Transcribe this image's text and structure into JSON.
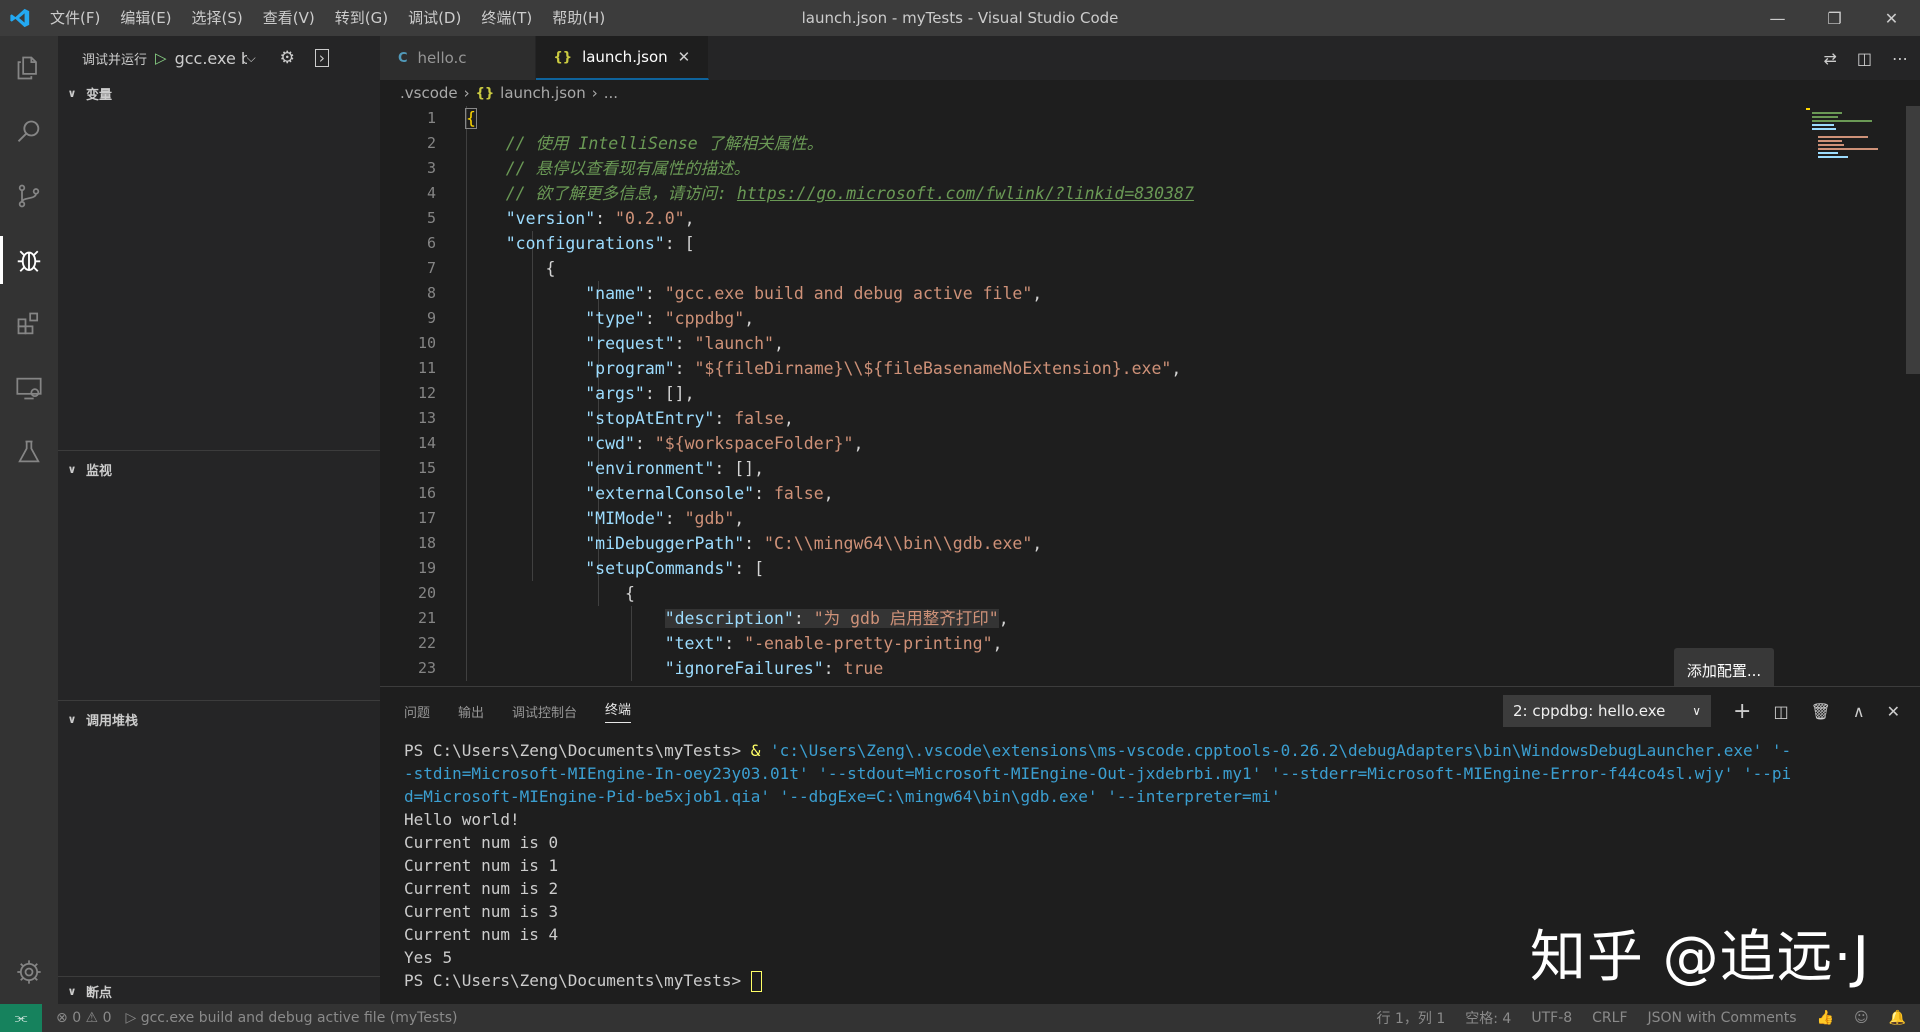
{
  "titlebar": {
    "menu": [
      "文件(F)",
      "编辑(E)",
      "选择(S)",
      "查看(V)",
      "转到(G)",
      "调试(D)",
      "终端(T)",
      "帮助(H)"
    ],
    "title": "launch.json - myTests - Visual Studio Code"
  },
  "sidebar": {
    "run_label": "调试并运行",
    "config_name": "gcc.exe build",
    "sections": {
      "variables": "变量",
      "watch": "监视",
      "callstack": "调用堆栈",
      "breakpoints": "断点"
    }
  },
  "tabs": [
    {
      "icon": "C",
      "label": "hello.c"
    },
    {
      "icon": "{}",
      "label": "launch.json"
    }
  ],
  "breadcrumb": [
    ".vscode",
    "launch.json",
    "..."
  ],
  "code": {
    "line_numbers": [
      "1",
      "2",
      "3",
      "4",
      "5",
      "6",
      "7",
      "8",
      "9",
      "10",
      "11",
      "12",
      "13",
      "14",
      "15",
      "16",
      "17",
      "18",
      "19",
      "20",
      "21",
      "22",
      "23"
    ],
    "comments": [
      "// 使用 IntelliSense 了解相关属性。",
      "// 悬停以查看现有属性的描述。",
      "// 欲了解更多信息，请访问: "
    ],
    "link": "https://go.microsoft.com/fwlink/?linkid=830387",
    "entries": {
      "version": {
        "key": "\"version\"",
        "value": "\"0.2.0\""
      },
      "configurations": {
        "key": "\"configurations\""
      },
      "name": {
        "key": "\"name\"",
        "value": "\"gcc.exe build and debug active file\""
      },
      "type": {
        "key": "\"type\"",
        "value": "\"cppdbg\""
      },
      "request": {
        "key": "\"request\"",
        "value": "\"launch\""
      },
      "program": {
        "key": "\"program\"",
        "value": "\"${fileDirname}\\\\${fileBasenameNoExtension}.exe\""
      },
      "args": {
        "key": "\"args\"",
        "value": "[]"
      },
      "stopAtEntry": {
        "key": "\"stopAtEntry\"",
        "value": "false"
      },
      "cwd": {
        "key": "\"cwd\"",
        "value": "\"${workspaceFolder}\""
      },
      "environment": {
        "key": "\"environment\"",
        "value": "[]"
      },
      "externalConsole": {
        "key": "\"externalConsole\"",
        "value": "false"
      },
      "MIMode": {
        "key": "\"MIMode\"",
        "value": "\"gdb\""
      },
      "miDebuggerPath": {
        "key": "\"miDebuggerPath\"",
        "value": "\"C:\\\\mingw64\\\\bin\\\\gdb.exe\""
      },
      "setupCommands": {
        "key": "\"setupCommands\""
      },
      "description": {
        "key": "\"description\"",
        "value": "\"为 gdb 启用整齐打印\""
      },
      "text": {
        "key": "\"text\"",
        "value": "\"-enable-pretty-printing\""
      },
      "ignoreFailures": {
        "key": "\"ignoreFailures\"",
        "value": "true"
      }
    }
  },
  "add_config_label": "添加配置...",
  "panel": {
    "tabs": [
      "问题",
      "输出",
      "调试控制台",
      "终端"
    ],
    "terminal_select": "2: cppdbg: hello.exe",
    "terminal": {
      "prompt": "PS C:\\Users\\Zeng\\Documents\\myTests> ",
      "amp": "& ",
      "cmd_line1_arg": "'c:\\Users\\Zeng\\.vscode\\extensions\\ms-vscode.cpptools-0.26.2\\debugAdapters\\bin\\WindowsDebugLauncher.exe' '-",
      "cmd_line2": "-stdin=Microsoft-MIEngine-In-oey23y03.01t' '--stdout=Microsoft-MIEngine-Out-jxdebrbi.my1' '--stderr=Microsoft-MIEngine-Error-f44co4sl.wjy' '--pi",
      "cmd_line3": "d=Microsoft-MIEngine-Pid-be5xjob1.qia' '--dbgExe=C:\\mingw64\\bin\\gdb.exe' '--interpreter=mi'",
      "output": [
        "Hello world!",
        "Current num is 0",
        "Current num is 1",
        "Current num is 2",
        "Current num is 3",
        "Current num is 4",
        "Yes 5"
      ]
    }
  },
  "watermark": "知乎 @追远·J",
  "statusbar": {
    "errors": "0",
    "warnings": "0",
    "debug_config": "gcc.exe build and debug active file (myTests)",
    "position": "行 1，列 1",
    "spaces": "空格: 4",
    "encoding": "UTF-8",
    "eol": "CRLF",
    "language": "JSON with Comments"
  },
  "colors": {
    "accent": "#0e639c",
    "remote": "#16825d",
    "key": "#9cdcfe",
    "string": "#ce9178",
    "comment": "#6a9955"
  }
}
